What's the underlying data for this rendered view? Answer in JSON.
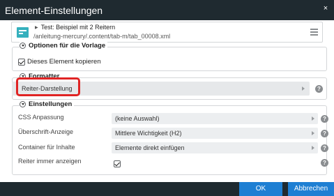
{
  "dialog": {
    "title": "Element-Einstellungen",
    "close_symbol": "×"
  },
  "resource": {
    "icon": "resource-type-icon",
    "expand_symbol": "▶",
    "title": "Test: Beispiel mit 2 Reitern",
    "path": "/anleitung-mercury/.content/tab-m/tab_00008.xml",
    "menu_icon": "hamburger-menu-icon"
  },
  "template_options": {
    "legend": "Optionen für die Vorlage",
    "copy_element": {
      "label": "Dieses Element kopieren",
      "checked": true
    }
  },
  "formatter": {
    "legend": "Formatter",
    "value": "Reiter-Darstellung"
  },
  "settings": {
    "legend": "Einstellungen",
    "rows": [
      {
        "label": "CSS Anpassung",
        "value": "(keine Auswahl)"
      },
      {
        "label": "Überschrift-Anzeige",
        "value": "Mittlere Wichtigkeit (H2)"
      },
      {
        "label": "Container für Inhalte",
        "value": "Elemente direkt einfügen"
      }
    ],
    "always_show_tabs": {
      "label": "Reiter immer anzeigen",
      "checked": true
    }
  },
  "help_symbol": "?",
  "buttons": {
    "ok": "OK",
    "cancel": "Abbrechen"
  },
  "colors": {
    "titlebar": "#1f2a30",
    "accent_button": "#1e7fd3",
    "resource_icon": "#35b0bd",
    "highlight": "#e02424"
  }
}
